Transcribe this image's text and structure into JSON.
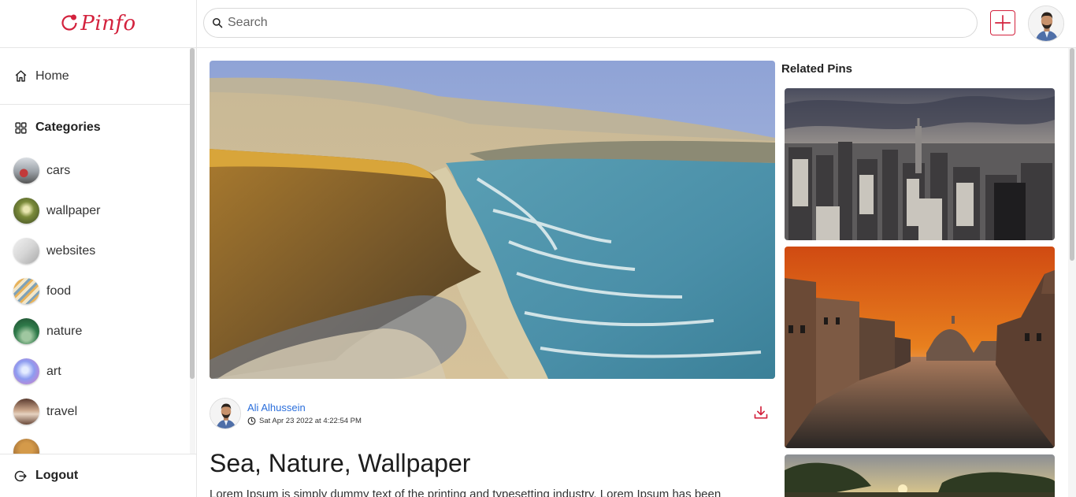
{
  "app": {
    "name": "Pinfo",
    "brand_color": "#d3223d"
  },
  "sidebar": {
    "home_label": "Home",
    "categories_title": "Categories",
    "categories": [
      {
        "label": "cars"
      },
      {
        "label": "wallpaper"
      },
      {
        "label": "websites"
      },
      {
        "label": "food"
      },
      {
        "label": "nature"
      },
      {
        "label": "art"
      },
      {
        "label": "travel"
      }
    ],
    "logout_label": "Logout"
  },
  "topbar": {
    "search_placeholder": "Search",
    "add_icon": "plus-icon",
    "user_avatar": "user-avatar"
  },
  "pin": {
    "author_name": "Ali Alhussein",
    "posted_at": "Sat Apr 23 2022 at 4:22:54 PM",
    "title": "Sea, Nature, Wallpaper",
    "description": "Lorem Ipsum is simply dummy text of the printing and typesetting industry. Lorem Ipsum has been"
  },
  "related": {
    "title": "Related Pins"
  }
}
